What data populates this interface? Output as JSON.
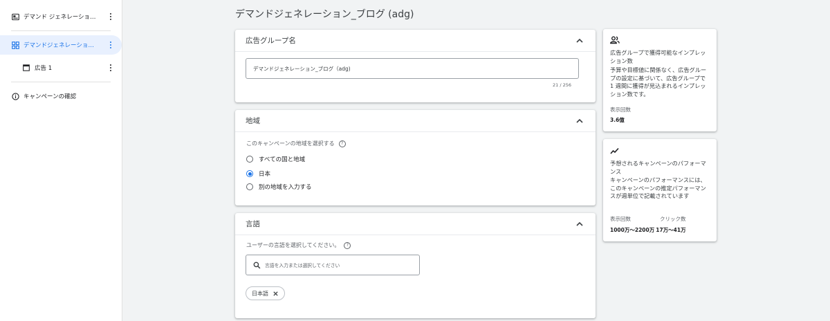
{
  "sidebar": {
    "items": [
      {
        "label": "デマンド ジェネレーショ…",
        "icon": "campaign-icon"
      },
      {
        "label": "デマンドジェネレーショ…",
        "icon": "ad-group-icon"
      },
      {
        "label": "広告 1",
        "icon": "ad-icon"
      },
      {
        "label": "キャンペーンの確認",
        "icon": "info-icon"
      }
    ]
  },
  "page": {
    "title": "デマンドジェネレーション_ブログ (adg)"
  },
  "ad_group_card": {
    "header": "広告グループ名",
    "input_value": "デマンドジェネレーション_ブログ（adg)",
    "char_count": "21 / 256"
  },
  "region_card": {
    "header": "地域",
    "question": "このキャンペーンの地域を選択する",
    "options": [
      {
        "label": "すべての国と地域",
        "selected": false
      },
      {
        "label": "日本",
        "selected": true
      },
      {
        "label": "別の地域を入力する",
        "selected": false
      }
    ]
  },
  "language_card": {
    "header": "言語",
    "question": "ユーザーの言語を選択してください。",
    "search_placeholder": "言語を入力または選択してください",
    "chip_label": "日本語"
  },
  "impressions_card": {
    "icon": "people-icon",
    "title": "広告グループで獲得可能なインプレッション数",
    "description": "予算や目標値に関係なく、広告グループの設定に基づいて、広告グループで 1 週間に獲得が見込まれるインプレッション数です。",
    "metric_label": "表示回数",
    "metric_value": "3.6億"
  },
  "performance_card": {
    "icon": "trending-icon",
    "title": "予想されるキャンペーンのパフォーマンス",
    "description": "キャンペーンのパフォーマンスには、このキャンペーンの推定パフォーマンスが週単位で記載されています",
    "metric1_label": "表示回数",
    "metric2_label": "クリック数",
    "metric1_value": "1000万～2200万",
    "metric2_value": "17万～41万"
  },
  "colors": {
    "accent": "#1a73e8",
    "background": "#f1f3f4",
    "active_bg": "#e8f0fe"
  }
}
